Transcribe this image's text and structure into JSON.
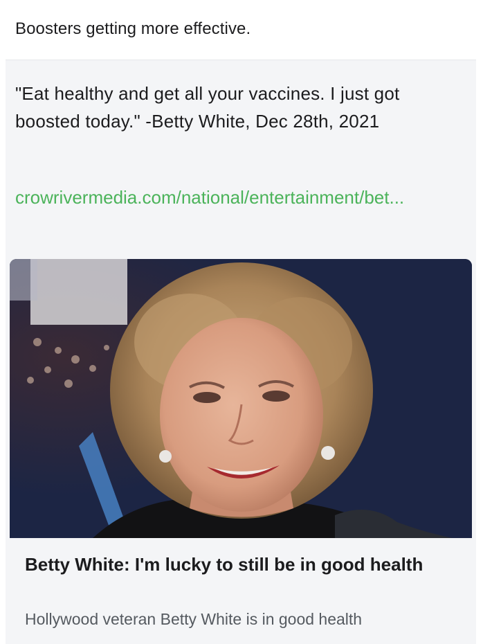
{
  "post": {
    "caption": "Boosters getting more effective."
  },
  "link_card": {
    "quote": "\"Eat healthy and get all your vaccines. I just got boosted today.\" -Betty White, Dec 28th, 2021",
    "url": "crowrivermedia.com/national/entertainment/bet...",
    "link_color": "#4bb35a",
    "image_icon": "photo-of-smiling-woman",
    "article_title": "Betty White: I'm lucky to still be in good health",
    "article_description": "Hollywood veteran Betty White is in good health"
  }
}
